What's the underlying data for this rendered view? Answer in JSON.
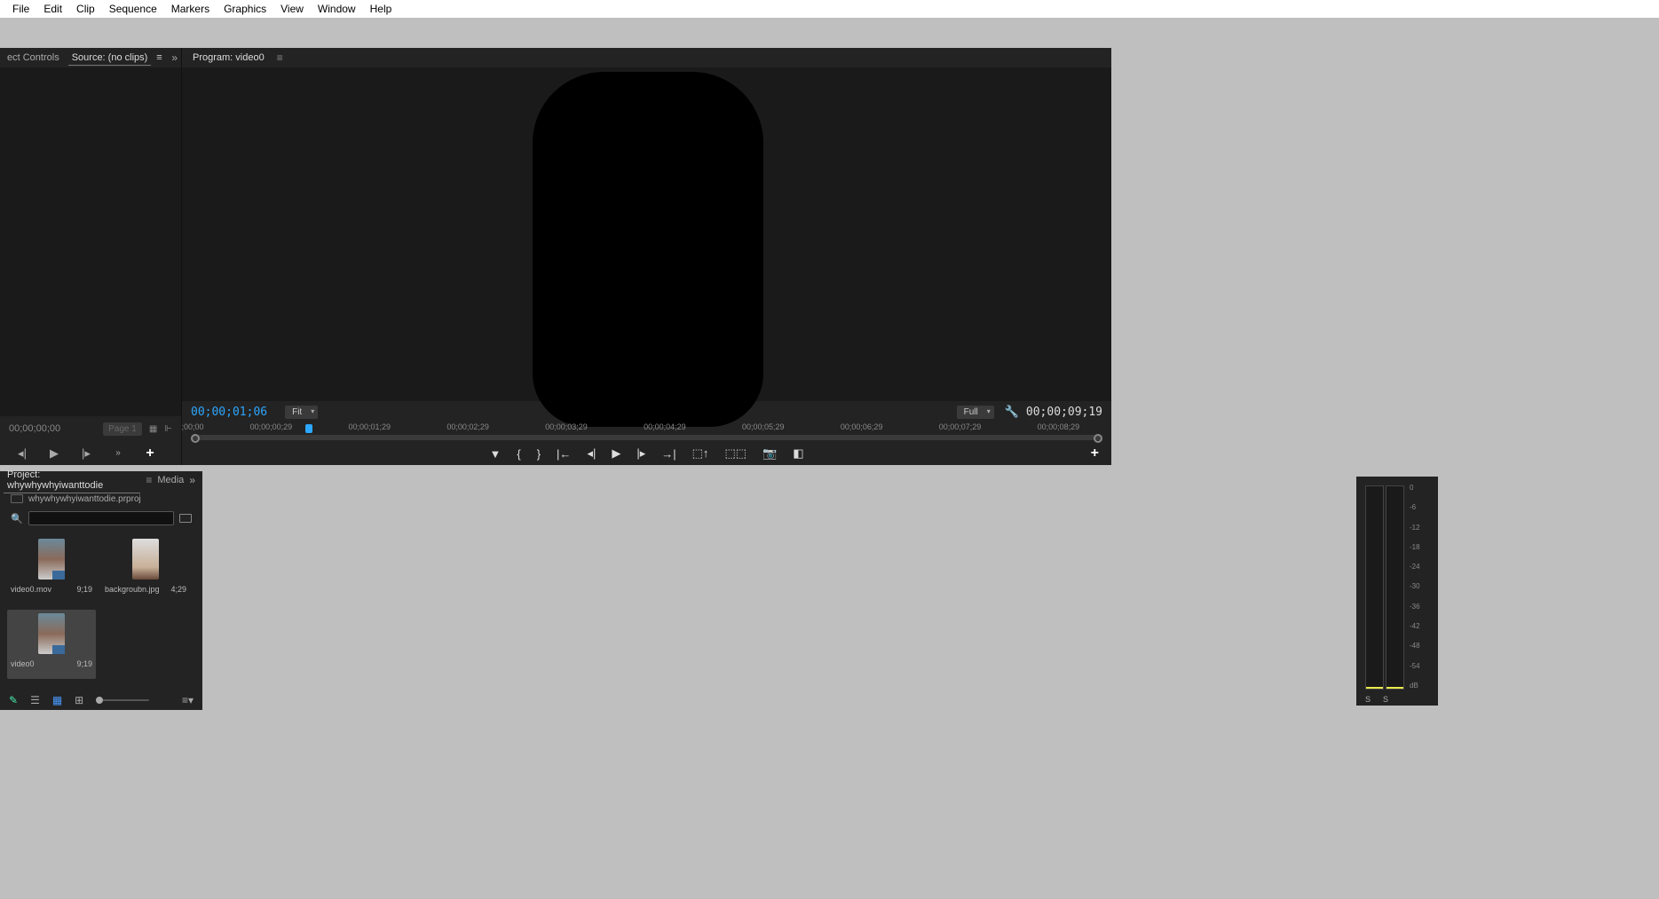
{
  "menu": [
    "File",
    "Edit",
    "Clip",
    "Sequence",
    "Markers",
    "Graphics",
    "View",
    "Window",
    "Help"
  ],
  "source": {
    "tab_controls": "ect Controls",
    "tab_source": "Source: (no clips)",
    "timecode": "00;00;00;00",
    "page": "Page 1"
  },
  "program": {
    "tab": "Program: video0",
    "current_tc": "00;00;01;06",
    "zoom": "Fit",
    "resolution": "Full",
    "duration_tc": "00;00;09;19",
    "ruler": [
      ";00;00",
      "00;00;00;29",
      "00;00;01;29",
      "00;00;02;29",
      "00;00;03;29",
      "00;00;04;29",
      "00;00;05;29",
      "00;00;06;29",
      "00;00;07;29",
      "00;00;08;29"
    ]
  },
  "project": {
    "tab": "Project: whywhywhyiwanttodie",
    "tab2": "Media",
    "filename": "whywhywhyiwanttodie.prproj",
    "items": [
      {
        "name": "video0.mov",
        "dur": "9;19",
        "selected": false,
        "type": "vid"
      },
      {
        "name": "backgroubn.jpg",
        "dur": "4;29",
        "selected": false,
        "type": "img"
      },
      {
        "name": "video0",
        "dur": "9;19",
        "selected": true,
        "type": "seq"
      }
    ]
  },
  "audio": {
    "scale": [
      "0",
      "-6",
      "-12",
      "-18",
      "-24",
      "-30",
      "-36",
      "-42",
      "-48",
      "-54",
      "dB"
    ],
    "solo": "S"
  }
}
